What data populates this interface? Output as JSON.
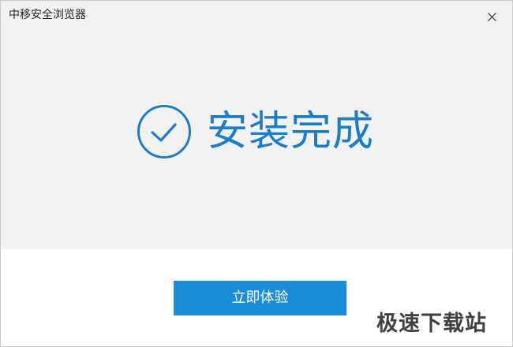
{
  "window": {
    "title": "中移安全浏览器"
  },
  "icons": {
    "close": "close-icon",
    "success": "check-circle-icon"
  },
  "main": {
    "status_text": "安装完成"
  },
  "actions": {
    "primary_label": "立即体验"
  },
  "watermark": {
    "text": "极速下载站"
  },
  "colors": {
    "accent": "#1a8cd8",
    "headline": "#1d7cc8",
    "top_background": "#f2f2f2",
    "bottom_background": "#ffffff"
  }
}
